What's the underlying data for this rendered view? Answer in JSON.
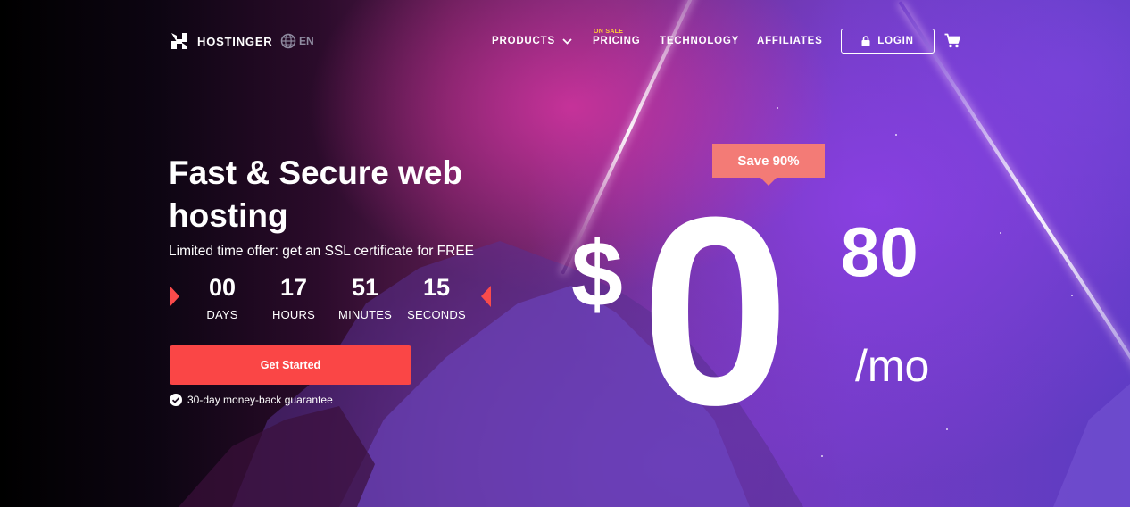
{
  "header": {
    "brand": "HOSTINGER",
    "language": "EN",
    "nav": {
      "products": "PRODUCTS",
      "pricing": "PRICING",
      "pricing_badge": "ON SALE",
      "technology": "TECHNOLOGY",
      "affiliates": "AFFILIATES"
    },
    "login": "LOGIN"
  },
  "hero": {
    "title": "Fast & Secure web hosting",
    "subtitle": "Limited time offer: get an SSL certificate for FREE",
    "countdown": [
      {
        "value": "00",
        "label": "DAYS"
      },
      {
        "value": "17",
        "label": "HOURS"
      },
      {
        "value": "51",
        "label": "MINUTES"
      },
      {
        "value": "15",
        "label": "SECONDS"
      }
    ],
    "cta": "Get Started",
    "guarantee": "30-day money-back guarantee"
  },
  "price": {
    "badge": "Save 90%",
    "currency": "$",
    "integer": "0",
    "cents": "80",
    "period": "/mo"
  },
  "colors": {
    "cta": "#fa4646",
    "badge": "#f37b76",
    "on_sale": "#ffcd35"
  },
  "icons": [
    "logo-icon",
    "globe-icon",
    "chevron-down-icon",
    "lock-icon",
    "cart-icon",
    "check-circle-icon"
  ]
}
